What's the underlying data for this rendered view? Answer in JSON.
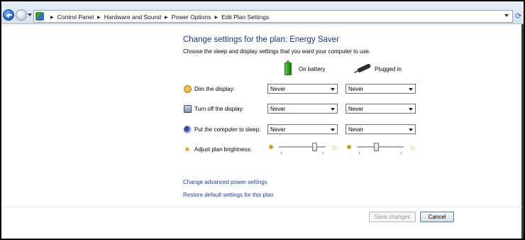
{
  "breadcrumb": [
    "Control Panel",
    "Hardware and Sound",
    "Power Options",
    "Edit Plan Settings"
  ],
  "icons": {
    "back": "back-arrow-icon",
    "forward": "forward-arrow-icon",
    "refresh": "refresh-icon",
    "battery": "battery-icon",
    "plug": "power-plug-icon",
    "dim": "dim-display-icon",
    "display_off": "monitor-icon",
    "sleep": "sleep-moon-icon",
    "brightness": "sun-icon"
  },
  "main": {
    "title": "Change settings for the plan: Energy Saver",
    "subtitle": "Choose the sleep and display settings that you want your computer to use.",
    "columns": {
      "battery": "On battery",
      "plugged": "Plugged in"
    },
    "rows": [
      {
        "label": "Dim the display:",
        "battery": "Never",
        "plugged": "Never"
      },
      {
        "label": "Turn off the display:",
        "battery": "Never",
        "plugged": "Never"
      },
      {
        "label": "Put the computer to sleep:",
        "battery": "Never",
        "plugged": "Never"
      }
    ],
    "brightness": {
      "label": "Adjust plan brightness:",
      "battery_level": 0.8,
      "plugged_level": 0.4
    },
    "links": {
      "advanced": "Change advanced power settings",
      "restore": "Restore default settings for this plan"
    }
  },
  "buttons": {
    "save": "Save changes",
    "cancel": "Cancel"
  },
  "colors": {
    "title": "#1e3287",
    "link": "#1b3d9a"
  }
}
